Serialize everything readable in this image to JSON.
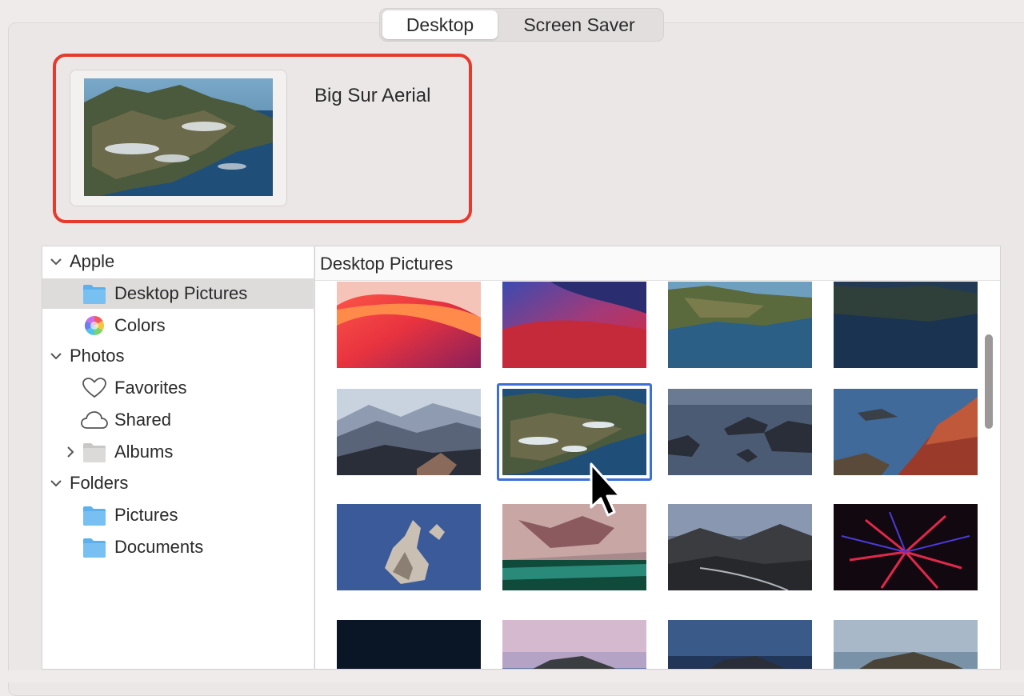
{
  "tabs": [
    {
      "label": "Desktop",
      "active": true
    },
    {
      "label": "Screen Saver",
      "active": false
    }
  ],
  "preview": {
    "name": "Big Sur Aerial"
  },
  "sidebar": {
    "items": [
      {
        "label": "Apple",
        "type": "group",
        "icon": "chevron-down-icon"
      },
      {
        "label": "Desktop Pictures",
        "type": "item",
        "icon": "folder-icon",
        "selected": true
      },
      {
        "label": "Colors",
        "type": "item",
        "icon": "color-wheel-icon"
      },
      {
        "label": "Photos",
        "type": "group",
        "icon": "chevron-down-icon"
      },
      {
        "label": "Favorites",
        "type": "item",
        "icon": "heart-icon"
      },
      {
        "label": "Shared",
        "type": "item",
        "icon": "cloud-icon"
      },
      {
        "label": "Albums",
        "type": "item",
        "icon": "folder-icon"
      },
      {
        "label": "Folders",
        "type": "group",
        "icon": "chevron-down-icon"
      },
      {
        "label": "Pictures",
        "type": "item",
        "icon": "folder-icon"
      },
      {
        "label": "Documents",
        "type": "item",
        "icon": "folder-icon"
      }
    ]
  },
  "grid": {
    "title": "Desktop Pictures",
    "selected_index": 5,
    "thumbnails": [
      "big-sur-gradient-coral",
      "big-sur-gradient-purple",
      "big-sur-coast-day",
      "big-sur-coast-dusk",
      "misty-mountains",
      "big-sur-aerial",
      "sea-rocks",
      "coastal-cliffs",
      "rock-island-blue",
      "pink-rock-cliff",
      "mountain-road",
      "red-plant",
      "blue-plant-dark",
      "catalina-island-pink",
      "catalina-island-dusk",
      "catalina-island-day"
    ]
  },
  "colors": {
    "accent": "#3d6fd9",
    "highlight": "#e53a2c",
    "folder": "#5eb0ec"
  }
}
